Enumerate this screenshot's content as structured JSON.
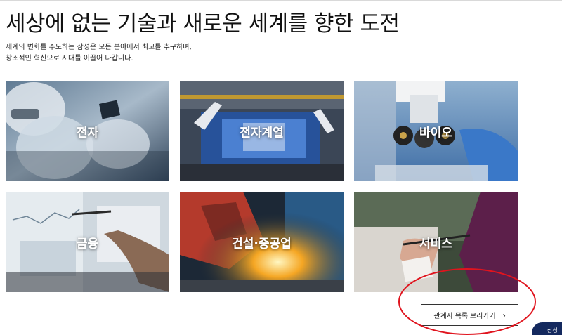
{
  "section": {
    "headline": "세상에 없는 기술과 새로운 세계를 향한 도전",
    "desc_line1": "세계의 변화를 주도하는 삼성은 모든 분야에서 최고를 추구하며,",
    "desc_line2": "창조적인 혁신으로 시대를 이끌어 나갑니다."
  },
  "tiles": [
    {
      "label": "전자"
    },
    {
      "label": "전자계열"
    },
    {
      "label": "바이오"
    },
    {
      "label": "금융"
    },
    {
      "label": "건설·중공업"
    },
    {
      "label": "서비스"
    }
  ],
  "more_button": {
    "label": "관계사 목록 보러가기",
    "icon": "chevron-right-icon"
  },
  "floating": {
    "label": "삼성"
  },
  "colors": {
    "annotation_circle": "#e0141e",
    "floating_pill": "#14295e"
  }
}
